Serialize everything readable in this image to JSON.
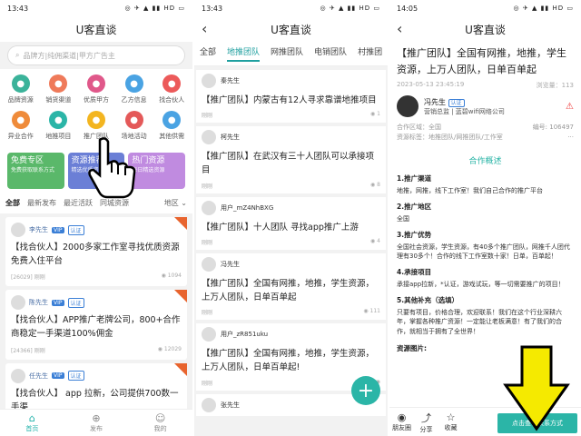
{
  "s1": {
    "time": "13:43",
    "title": "U客直谈",
    "search_placeholder": "品牌方|纯佣渠道|甲方广告主",
    "grid": [
      {
        "label": "品牌资源",
        "color": "#3bb39a"
      },
      {
        "label": "销货渠道",
        "color": "#ef7a5a"
      },
      {
        "label": "优质甲方",
        "color": "#e0588a"
      },
      {
        "label": "乙方信息",
        "color": "#4aa3e3"
      },
      {
        "label": "找合伙人",
        "color": "#ec5a5a"
      },
      {
        "label": "异业合作",
        "color": "#ef8b3a"
      },
      {
        "label": "地推项目",
        "color": "#2bb5a7"
      },
      {
        "label": "推广团队",
        "color": "#f3b520"
      },
      {
        "label": "场地活动",
        "color": "#e45959"
      },
      {
        "label": "其他供需",
        "color": "#4aa3e3"
      }
    ],
    "banners": [
      {
        "title": "免费专区",
        "sub": "免费获取联系方式"
      },
      {
        "title": "资源推荐",
        "sub": "精选优质资源"
      },
      {
        "title": "热门资源",
        "sub": "每日精选资源"
      }
    ],
    "tabs": [
      "全部",
      "最新发布",
      "最近活跃",
      "同城资源",
      "地区"
    ],
    "cards": [
      {
        "user": "李先生",
        "vip": "VIP",
        "auth": "认证",
        "title": "【找合伙人】2000多家工作室寻找优质资源免费入住平台",
        "id": "[26029]",
        "time": "刚刚",
        "views": "1094"
      },
      {
        "user": "陈先生",
        "vip": "VIP",
        "auth": "认证",
        "title": "【找合伙人】APP推广老牌公司，800+合作商稳定一手渠道100%佣金",
        "id": "[24366]",
        "time": "刚刚",
        "views": "12029"
      },
      {
        "user": "任先生",
        "vip": "VIP",
        "auth": "认证",
        "title": "【找合伙人】 app 拉新，公司提供700数一手渠"
      }
    ],
    "bnav": [
      "首页",
      "发布",
      "我的"
    ]
  },
  "s2": {
    "time": "13:43",
    "title": "U客直谈",
    "cats": [
      "全部",
      "地推团队",
      "网推团队",
      "电销团队",
      "村推团"
    ],
    "items": [
      {
        "user": "秦先生",
        "text": "【推广团队】内蒙古有12人寻求靠谱地推项目",
        "time": "刚刚",
        "views": "1"
      },
      {
        "user": "柯先生",
        "text": "【推广团队】在武汉有三十人团队可以承接项目",
        "time": "刚刚",
        "views": "8"
      },
      {
        "user": "用户_mZ4NhBXG",
        "text": "【推广团队】十人团队 寻找app推广上游",
        "time": "刚刚",
        "views": "4"
      },
      {
        "user": "冯先生",
        "text": "【推广团队】全国有网推，地推，学生资源，上万人团队，日单百单起",
        "time": "刚刚",
        "views": "111"
      },
      {
        "user": "用户_zR851uku",
        "text": "【推广团队】全国有网推，地推，学生资源，上万人团队，日单百单起!",
        "time": "刚刚",
        "views": ""
      },
      {
        "user": "张先生",
        "text": ""
      }
    ]
  },
  "s3": {
    "time": "14:05",
    "title": "U客直谈",
    "headline": "【推广团队】全国有网推，地推，学生资源，上万人团队，日单百单起",
    "date": "2023-05-13 23:45:19",
    "views": "浏览量：113",
    "user": "冯先生",
    "auth": "认证",
    "company": "营销总监 | 蓝碧wifi网络公司",
    "region": "合作区域：全国",
    "serial": "编号: 106497",
    "tags": "资源标签：地推团队/网推团队/工作室",
    "section": "合作概述",
    "blocks": [
      {
        "h": "1.推广渠道",
        "t": "地推，网推，线下工作室！我们自己合作的推广平台"
      },
      {
        "h": "2.推广地区",
        "t": "全国"
      },
      {
        "h": "3.推广优势",
        "t": "全国社会资源，学生资源，有40多个推广团队，网推千人团代理有30多个！合作的线下工作室数十家！日单，百单起！"
      },
      {
        "h": "4.承接项目",
        "t": "承接app拉新，*认证，游戏试玩，等一切需要推广的项目！"
      },
      {
        "h": "5.其他补充（选填）",
        "t": "只要有项目，价格合理，欢迎联系！我们在这个行业深耕六年，掌握各种推广资源！一定能让老板满意！有了我们的合作，就相当于拥有了全世界！"
      }
    ],
    "images_label": "资源图片:",
    "bottom": [
      "朋友圈",
      "分享",
      "收藏"
    ],
    "contact": "点击查看联系方式"
  }
}
